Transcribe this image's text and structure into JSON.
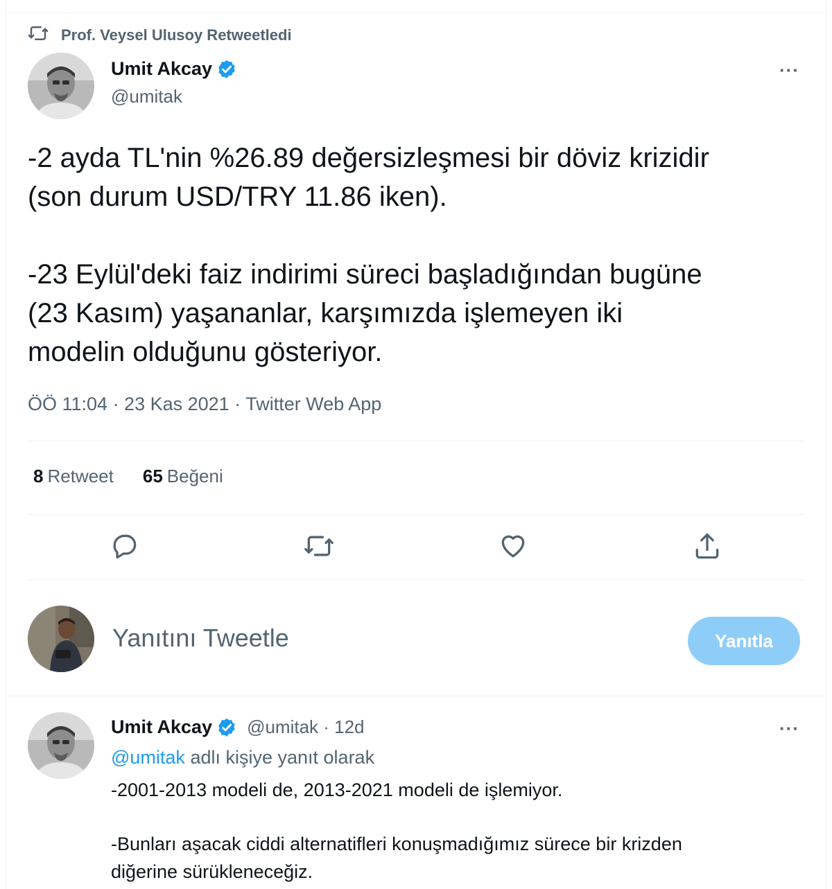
{
  "retweet_context": {
    "label": "Prof. Veysel Ulusoy Retweetledi",
    "icon": "retweet-icon"
  },
  "main_tweet": {
    "author_name": "Umit Akcay",
    "handle": "@umitak",
    "verified_icon": "verified-badge-icon",
    "more_label": "···",
    "text_lines": [
      "-2 ayda TL'nin %26.89 değersizleşmesi bir döviz krizidir",
      "(son durum USD/TRY 11.86 iken).",
      "-23 Eylül'deki faiz indirimi süreci başladığından bugüne",
      "(23 Kasım) yaşananlar, karşımızda işlemeyen iki",
      "modelin olduğunu gösteriyor."
    ],
    "meta": "ÖÖ 11:04 · 23 Kas 2021 · Twitter Web App",
    "retweet_count": "8",
    "retweet_label": "Retweet",
    "like_count": "65",
    "like_label": "Beğeni"
  },
  "actions": [
    {
      "name": "reply",
      "icon": "reply-icon"
    },
    {
      "name": "retweet",
      "icon": "retweet-icon"
    },
    {
      "name": "like",
      "icon": "heart-icon"
    },
    {
      "name": "share",
      "icon": "share-icon"
    }
  ],
  "composer": {
    "placeholder": "Yanıtını Tweetle",
    "button_label": "Yanıtla"
  },
  "reply_tweet": {
    "author_name": "Umit Akcay",
    "handle_time": "@umitak · 12d",
    "more_label": "···",
    "reply_mention": "@umitak",
    "reply_suffix": "adlı kişiye yanıt olarak",
    "text_lines": [
      "-2001-2013 modeli de, 2013-2021 modeli de işlemiyor.",
      "-Bunları aşacak ciddi alternatifleri konuşmadığımız sürece bir krizden",
      "diğerine sürükleneceğiz."
    ]
  },
  "colors": {
    "text": "#0f1419",
    "secondary": "#536471",
    "accent": "#1d9bf0",
    "button_disabled": "#8ecdf8",
    "divider": "#eff3f4"
  }
}
